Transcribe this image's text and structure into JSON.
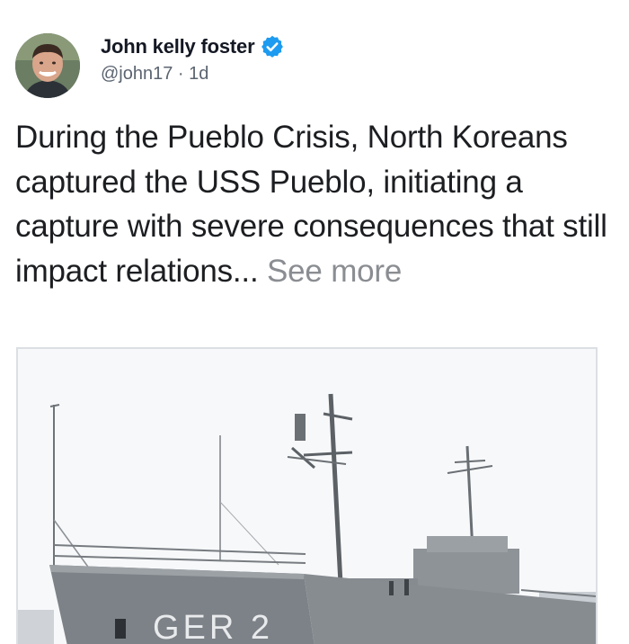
{
  "post": {
    "author_name": "John kelly foster",
    "handle": "@john17",
    "separator": " · ",
    "time": "1d",
    "verified": true,
    "body": "During the Pueblo Crisis, North Koreans captured the USS Pueblo, initiating a capture with severe consequences that still impact relations...",
    "see_more": "See more",
    "image": {
      "hull_text": "GER 2"
    }
  },
  "icons": {
    "verified": "verified-badge-icon"
  },
  "colors": {
    "verified_blue": "#1d9bf0",
    "name": "#141823",
    "meta": "#5b6470",
    "see_more": "#8a8d91",
    "body": "#1c1e21",
    "hull": "#7d8288"
  }
}
